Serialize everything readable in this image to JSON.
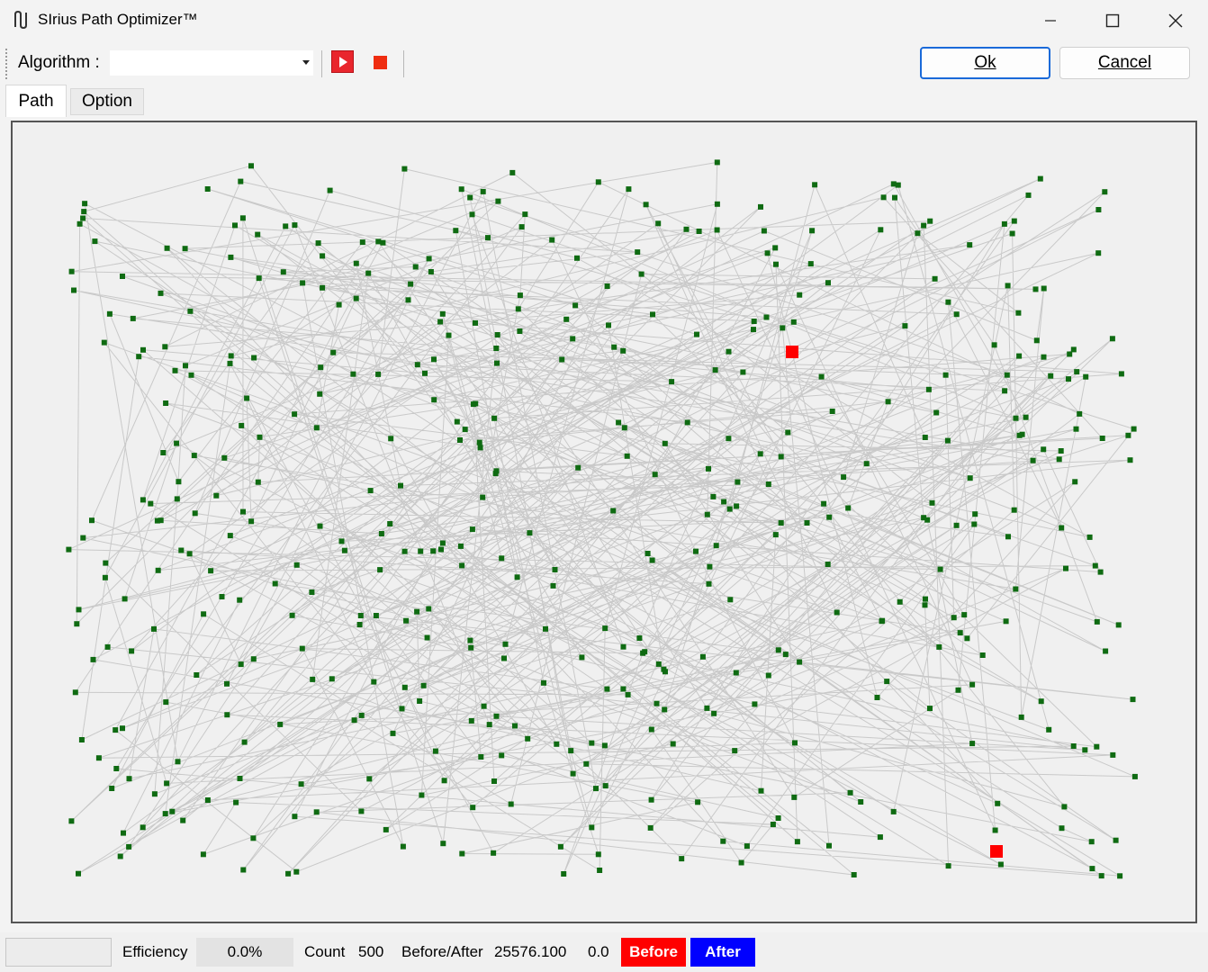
{
  "window": {
    "title": "SIrius Path Optimizer™",
    "app_icon": "path-logo-icon",
    "controls": [
      "minimize-icon",
      "maximize-icon",
      "close-icon"
    ]
  },
  "toolbar": {
    "algorithm_label": "Algorithm :",
    "algorithm_value": "",
    "run_icon": "play-icon",
    "stop_icon": "stop-icon",
    "ok_label": "Ok",
    "cancel_label": "Cancel"
  },
  "tabs": [
    {
      "label": "Path",
      "active": true
    },
    {
      "label": "Option",
      "active": false
    }
  ],
  "canvas": {
    "point_count": 500,
    "point_color": "#0f6b12",
    "line_color": "#c9c9c9",
    "marker_color": "#ff0000",
    "background": "#f0f0f0"
  },
  "status": {
    "efficiency_label": "Efficiency",
    "efficiency_value": "0.0%",
    "count_label": "Count",
    "count_value": "500",
    "before_after_label": "Before/After",
    "before_value": "25576.100",
    "after_value": "0.0",
    "before_button": "Before",
    "after_button": "After",
    "before_color": "#ff0000",
    "after_color": "#0000ff"
  }
}
